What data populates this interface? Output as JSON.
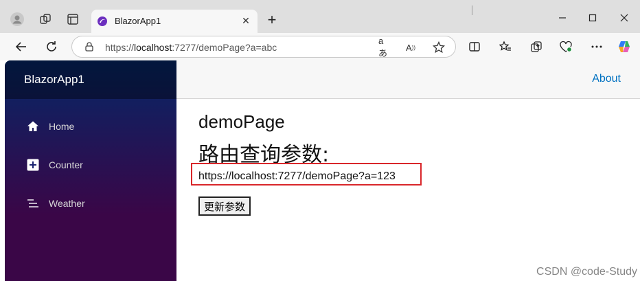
{
  "browser": {
    "tab_title": "BlazorApp1",
    "url_prefix": "https://",
    "url_host": "localhost",
    "url_rest": ":7277/demoPage?a=abc"
  },
  "sidebar": {
    "brand": "BlazorApp1",
    "items": [
      {
        "label": "Home",
        "icon": "home-icon"
      },
      {
        "label": "Counter",
        "icon": "plus-square-icon"
      },
      {
        "label": "Weather",
        "icon": "list-icon"
      }
    ]
  },
  "top_row": {
    "about": "About"
  },
  "main": {
    "page_title": "demoPage",
    "heading": "路由查询参数:",
    "current_url": "https://localhost:7277/demoPage?a=123",
    "update_button": "更新参数"
  },
  "watermark": "CSDN @code-Study",
  "colors": {
    "sidebar_top": "#052767",
    "sidebar_bottom": "#3a0647",
    "link": "#0071c1",
    "highlight": "#d9262a"
  }
}
